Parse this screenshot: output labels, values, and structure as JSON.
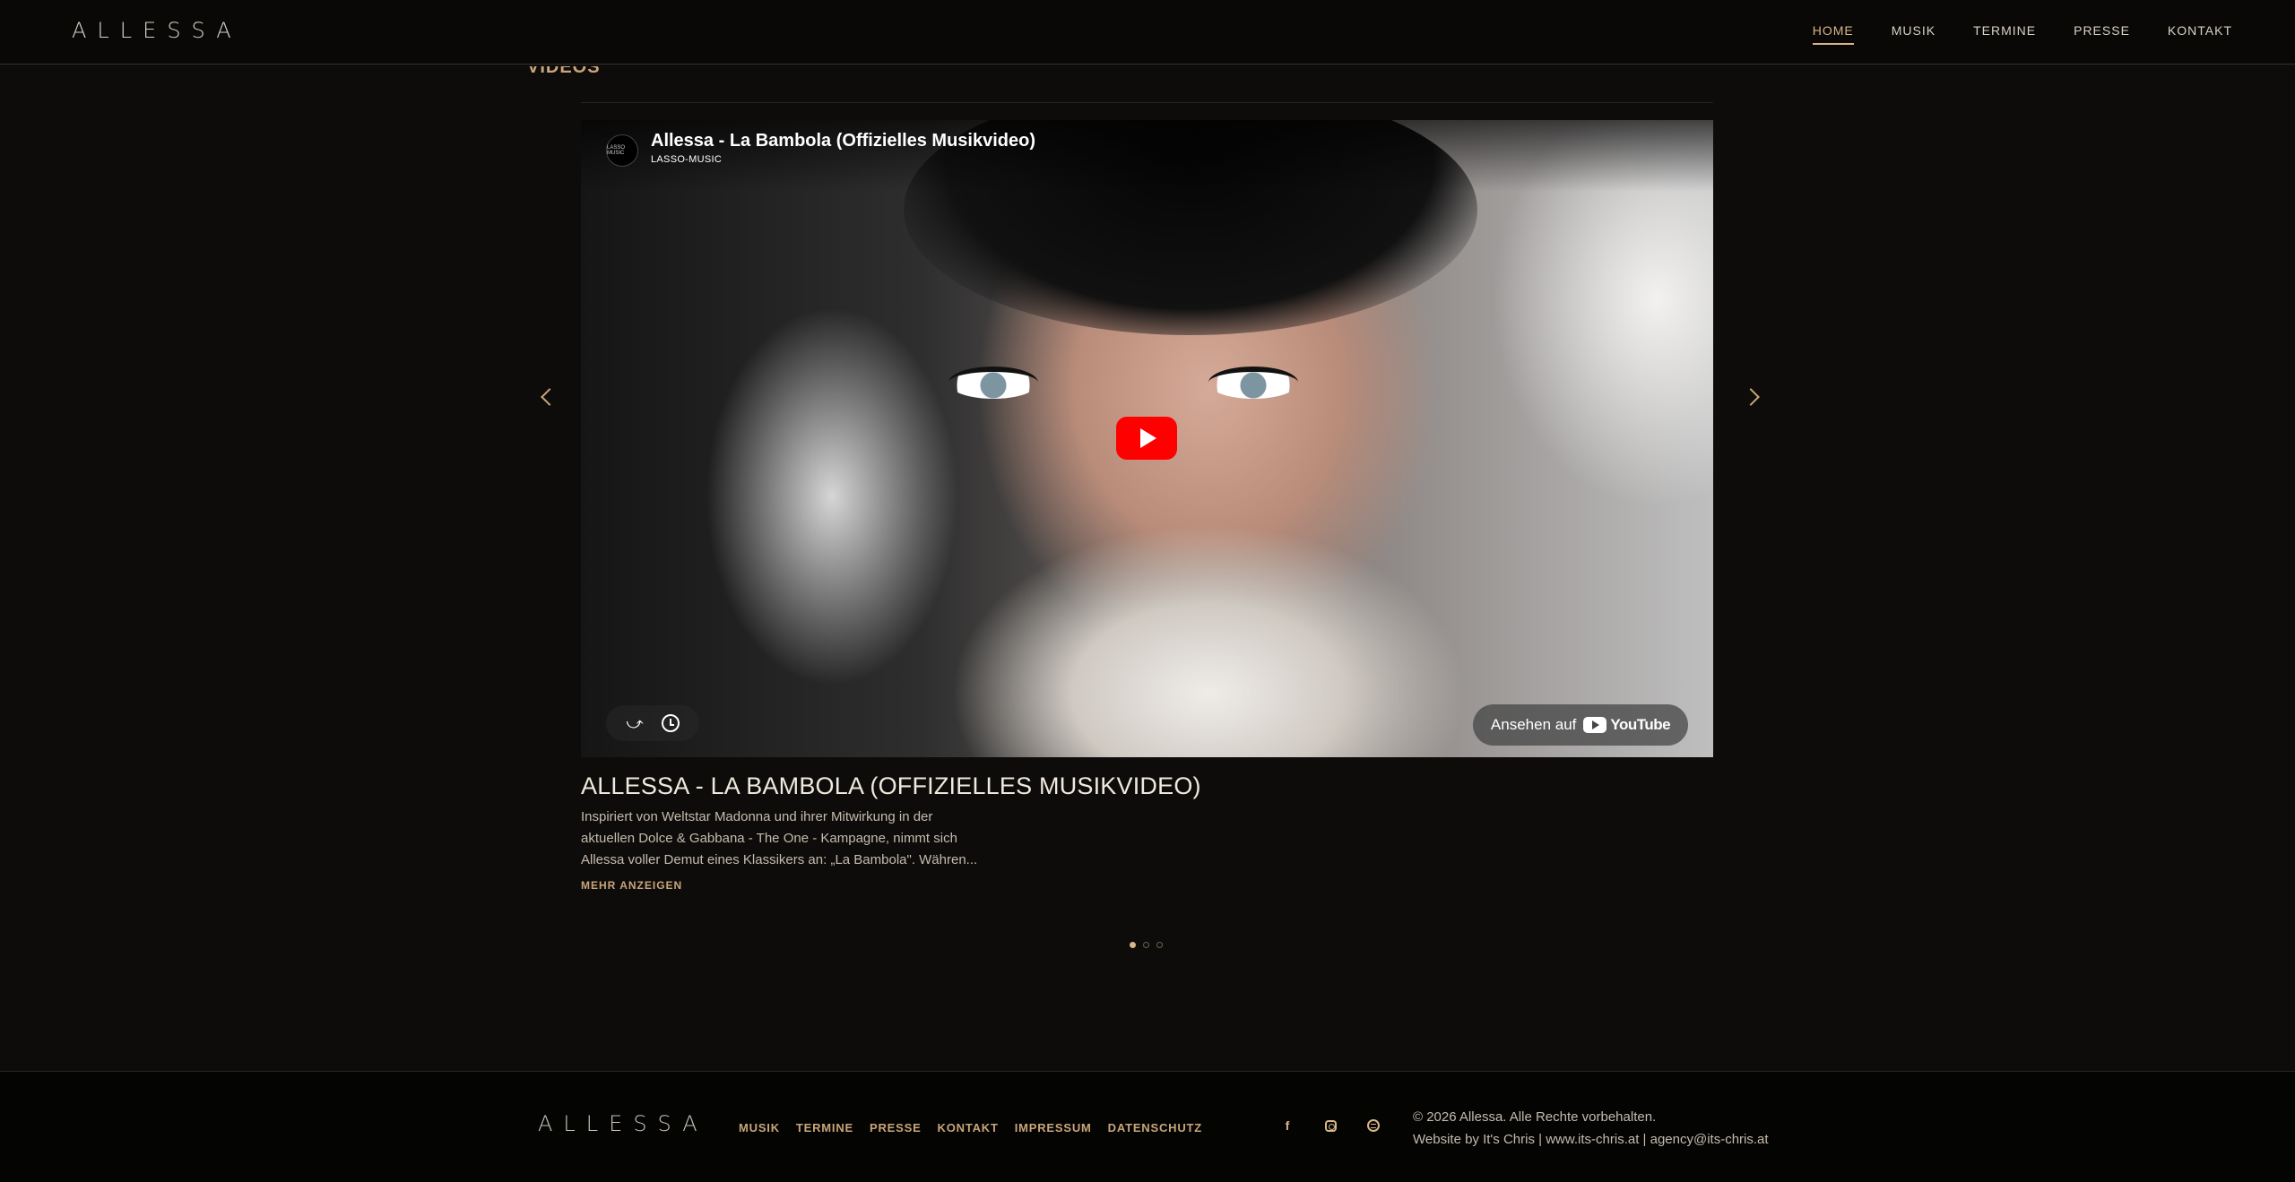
{
  "header": {
    "logo": "ALLESSA",
    "nav": [
      {
        "label": "HOME",
        "active": true
      },
      {
        "label": "MUSIK",
        "active": false
      },
      {
        "label": "TERMINE",
        "active": false
      },
      {
        "label": "PRESSE",
        "active": false
      },
      {
        "label": "KONTAKT",
        "active": false
      }
    ]
  },
  "section": {
    "title": "VIDEOS"
  },
  "video": {
    "embed_title": "Allessa - La Bambola (Offizielles Musikvideo)",
    "channel": "LASSO-MUSIC",
    "channel_logo_text": "LASSO MUSIC",
    "watch_on": "Ansehen auf",
    "youtube_label": "YouTube",
    "heading": "ALLESSA - LA BAMBOLA (OFFIZIELLES MUSIKVIDEO)",
    "description_lines": [
      "Inspiriert von Weltstar Madonna und ihrer Mitwirkung in der",
      "aktuellen Dolce & Gabbana - The One - Kampagne, nimmt sich",
      "Allessa voller Demut eines Klassikers an: „La Bambola\". Währen..."
    ],
    "more_label": "MEHR ANZEIGEN"
  },
  "carousel": {
    "slide_count": 3,
    "active_index": 0
  },
  "footer": {
    "logo": "ALLESSA",
    "links": [
      "MUSIK",
      "TERMINE",
      "PRESSE",
      "KONTAKT",
      "IMPRESSUM",
      "DATENSCHUTZ"
    ],
    "copyright_line1": "© 2026 Allessa. Alle Rechte vorbehalten.",
    "copyright_line2": "Website by It's Chris | www.its-chris.at | agency@its-chris.at"
  },
  "colors": {
    "accent": "#c9a57a",
    "background": "#0e0c0a",
    "youtube_red": "#ff0000"
  }
}
